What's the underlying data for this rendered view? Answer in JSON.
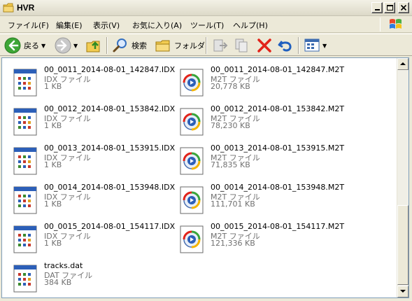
{
  "window": {
    "title": "HVR"
  },
  "menu": [
    {
      "label": "ファイル(F)"
    },
    {
      "label": "編集(E)"
    },
    {
      "label": "表示(V)"
    },
    {
      "label": "お気に入り(A)"
    },
    {
      "label": "ツール(T)"
    },
    {
      "label": "ヘルプ(H)"
    }
  ],
  "toolbar": {
    "back_label": "戻る",
    "search_label": "検索",
    "folders_label": "フォルダ"
  },
  "files": [
    {
      "name": "00_0011_2014-08-01_142847.IDX",
      "type": "IDX ファイル",
      "size": "1 KB",
      "icon": "idx-file-icon"
    },
    {
      "name": "00_0011_2014-08-01_142847.M2T",
      "type": "M2T ファイル",
      "size": "20,778 KB",
      "icon": "m2t-media-icon"
    },
    {
      "name": "00_0012_2014-08-01_153842.IDX",
      "type": "IDX ファイル",
      "size": "1 KB",
      "icon": "idx-file-icon"
    },
    {
      "name": "00_0012_2014-08-01_153842.M2T",
      "type": "M2T ファイル",
      "size": "78,230 KB",
      "icon": "m2t-media-icon"
    },
    {
      "name": "00_0013_2014-08-01_153915.IDX",
      "type": "IDX ファイル",
      "size": "1 KB",
      "icon": "idx-file-icon"
    },
    {
      "name": "00_0013_2014-08-01_153915.M2T",
      "type": "M2T ファイル",
      "size": "71,835 KB",
      "icon": "m2t-media-icon"
    },
    {
      "name": "00_0014_2014-08-01_153948.IDX",
      "type": "IDX ファイル",
      "size": "1 KB",
      "icon": "idx-file-icon"
    },
    {
      "name": "00_0014_2014-08-01_153948.M2T",
      "type": "M2T ファイル",
      "size": "111,701 KB",
      "icon": "m2t-media-icon"
    },
    {
      "name": "00_0015_2014-08-01_154117.IDX",
      "type": "IDX ファイル",
      "size": "1 KB",
      "icon": "idx-file-icon"
    },
    {
      "name": "00_0015_2014-08-01_154117.M2T",
      "type": "M2T ファイル",
      "size": "121,336 KB",
      "icon": "m2t-media-icon"
    },
    {
      "name": "tracks.dat",
      "type": "DAT ファイル",
      "size": "384 KB",
      "icon": "dat-file-icon"
    }
  ],
  "colors": {
    "window_bg": "#ece9d8",
    "content_bg": "#ffffff",
    "meta_text": "#707070",
    "close_red": "#e2231a",
    "undo_blue": "#1f5fbf"
  }
}
